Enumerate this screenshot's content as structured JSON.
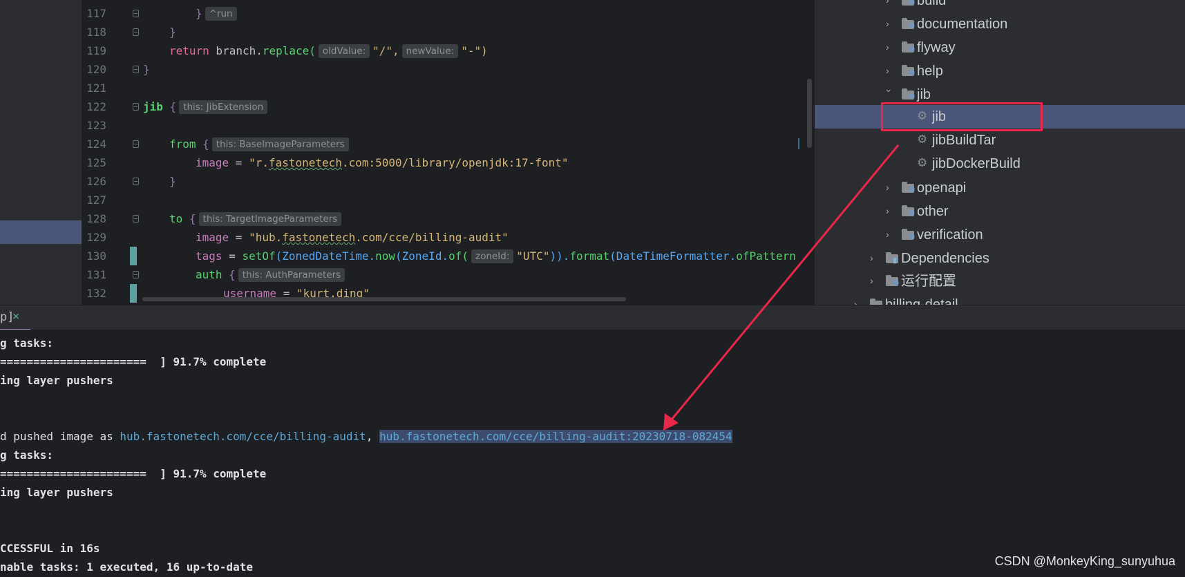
{
  "editor": {
    "line_numbers": [
      "117",
      "118",
      "119",
      "120",
      "121",
      "122",
      "123",
      "124",
      "125",
      "126",
      "127",
      "128",
      "129",
      "130",
      "131",
      "132"
    ],
    "lines": {
      "l117_brace": "}",
      "l117_hint": "^run",
      "l118": "}",
      "l119_return": "return",
      "l119_branch": " branch.",
      "l119_replace": "replace(",
      "l119_hint1": "oldValue:",
      "l119_arg1": "\"/\",",
      "l119_hint2": "newValue:",
      "l119_arg2": "\"-\")",
      "l120": "}",
      "l122_jib": "jib",
      "l122_brace": " {",
      "l122_hint": "this: JibExtension",
      "l124_from": "from",
      "l124_brace": " {",
      "l124_hint": "this: BaseImageParameters",
      "l125_image": "image",
      "l125_eq": " = ",
      "l125_str_a": "\"r.",
      "l125_str_b": "fastonetech",
      "l125_str_c": ".com:5000/library/openjdk:17-font\"",
      "l126": "}",
      "l128_to": "to",
      "l128_brace": " {",
      "l128_hint": "this: TargetImageParameters",
      "l129_image": "image",
      "l129_eq": " = ",
      "l129_str_a": "\"hub.",
      "l129_str_b": "fastonetech",
      "l129_str_c": ".com/cce/billing-audit\"",
      "l130_tags": "tags",
      "l130_eq": " = ",
      "l130_setof": "setOf",
      "l130_p1": "(ZonedDateTime.",
      "l130_now": "now",
      "l130_p2": "(ZoneId.",
      "l130_of": "of(",
      "l130_hint": "zoneId:",
      "l130_str": "\"UTC\"",
      "l130_p3": ")).",
      "l130_format": "format",
      "l130_p4": "(DateTimeFormatter.",
      "l130_ofpattern": "ofPattern",
      "l131_auth": "auth",
      "l131_brace": " {",
      "l131_hint": "this: AuthParameters",
      "l132_username": "username",
      "l132_eq": " = ",
      "l132_str": "\"kurt.ding\""
    }
  },
  "tree": {
    "items": [
      {
        "label": "build",
        "type": "folder",
        "state": "collapsed"
      },
      {
        "label": "documentation",
        "type": "folder",
        "state": "collapsed"
      },
      {
        "label": "flyway",
        "type": "folder",
        "state": "collapsed"
      },
      {
        "label": "help",
        "type": "folder",
        "state": "collapsed"
      },
      {
        "label": "jib",
        "type": "folder",
        "state": "expanded"
      },
      {
        "label": "jib",
        "type": "task",
        "selected": true
      },
      {
        "label": "jibBuildTar",
        "type": "task"
      },
      {
        "label": "jibDockerBuild",
        "type": "task"
      },
      {
        "label": "openapi",
        "type": "folder",
        "state": "collapsed"
      },
      {
        "label": "other",
        "type": "folder",
        "state": "collapsed"
      },
      {
        "label": "verification",
        "type": "folder",
        "state": "collapsed"
      },
      {
        "label": "Dependencies",
        "type": "dependencies",
        "state": "collapsed"
      },
      {
        "label": "运行配置",
        "type": "folder",
        "state": "collapsed"
      },
      {
        "label": "billing-detail",
        "type": "module",
        "state": "collapsed"
      }
    ]
  },
  "run_tab": {
    "label": "p]",
    "close": "×"
  },
  "console": {
    "lines": [
      "g tasks:",
      "======================  ] 91.7% complete",
      "ing layer pushers",
      "",
      "",
      "d pushed image as ",
      "g tasks:",
      "======================  ] 91.7% complete",
      "ing layer pushers",
      "",
      "",
      "CCESSFUL in 16s",
      "nable tasks: 1 executed, 16 up-to-date"
    ],
    "pushed_link_1": "hub.fastonetech.com/cce/billing-audit",
    "pushed_sep": ", ",
    "pushed_link_2": "hub.fastonetech.com/cce/billing-audit:20230718-082454"
  },
  "watermark": "CSDN @MonkeyKing_sunyuhua",
  "colors": {
    "annotation_red": "#e8274b",
    "selection": "#4b5479",
    "editor_bg": "#1e1f22",
    "panel_bg": "#2b2d30"
  }
}
